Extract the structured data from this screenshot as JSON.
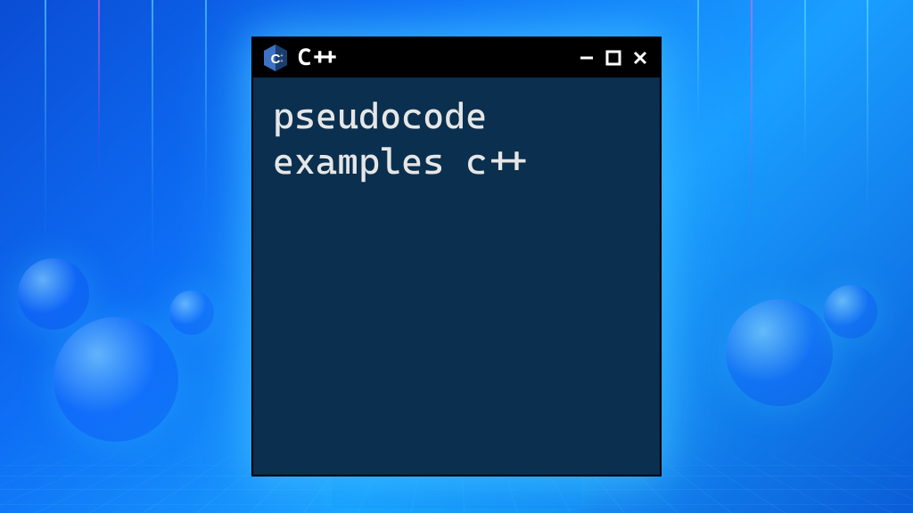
{
  "window": {
    "title": "C++",
    "icon_name": "cpp"
  },
  "content": {
    "text": "pseudocode examples c++"
  },
  "controls": {
    "minimize": "−",
    "maximize": "□",
    "close": "✕"
  }
}
